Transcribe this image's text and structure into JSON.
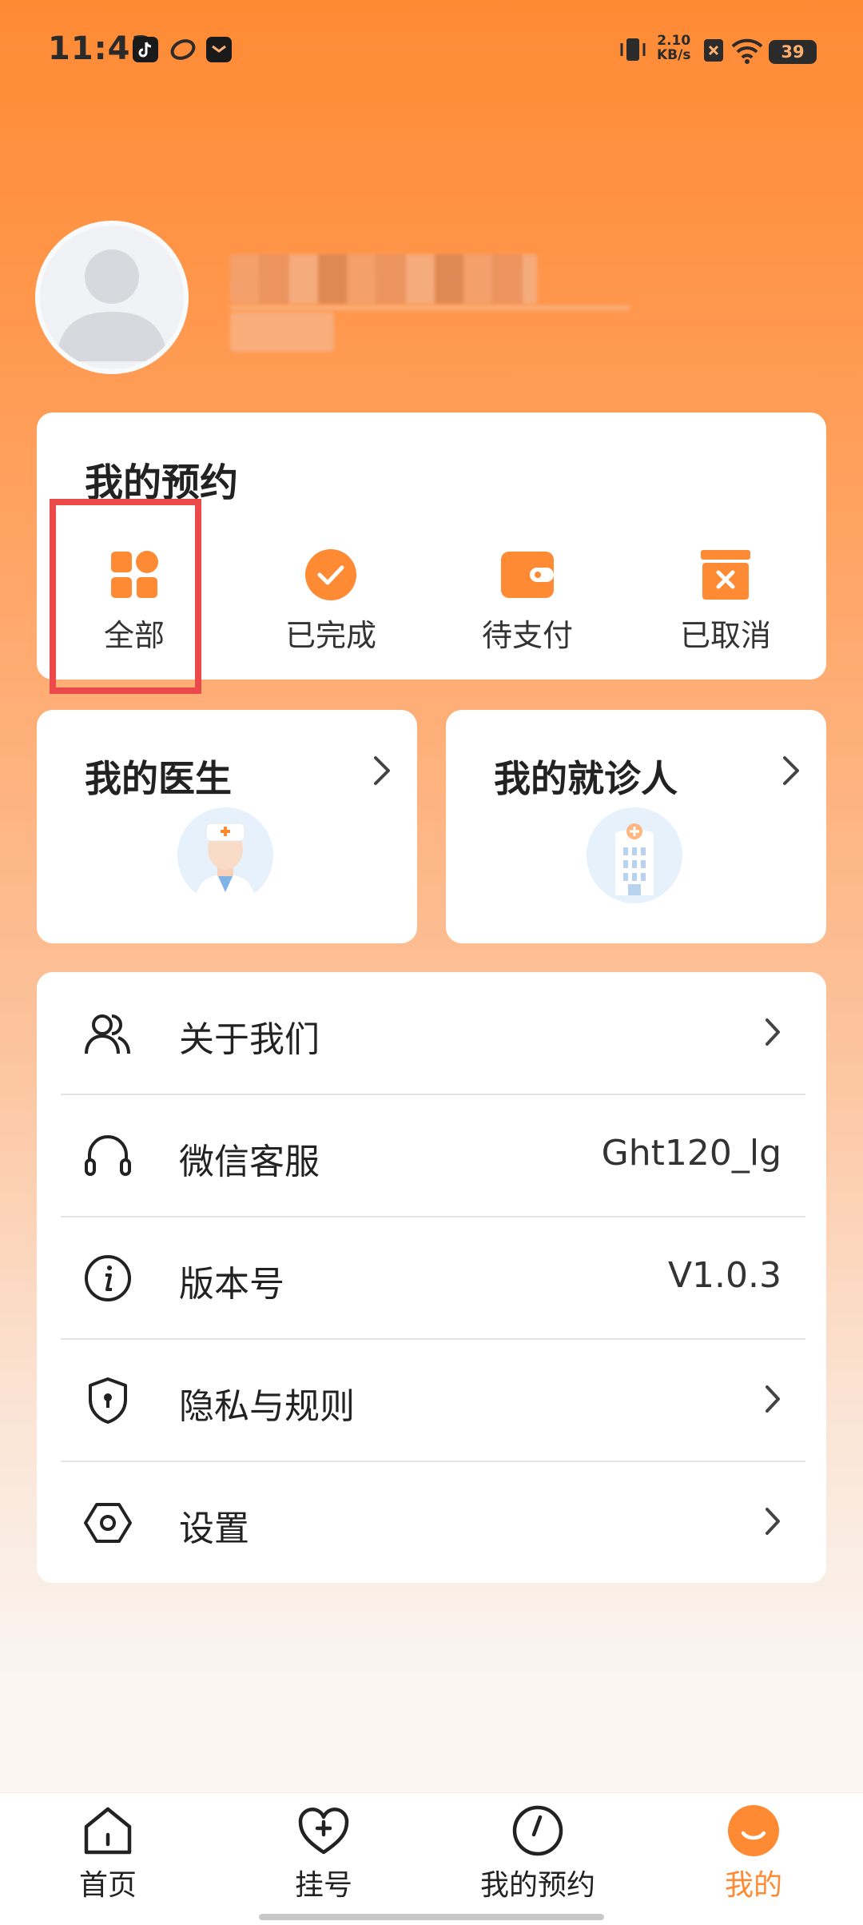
{
  "status_bar": {
    "time": "11:43",
    "net_speed_value": "2.10",
    "net_speed_unit": "KB/s",
    "battery": "39"
  },
  "appointments": {
    "title": "我的预约",
    "items": [
      {
        "label": "全部",
        "icon": "grid-icon"
      },
      {
        "label": "已完成",
        "icon": "check-circle-icon"
      },
      {
        "label": "待支付",
        "icon": "wallet-icon"
      },
      {
        "label": "已取消",
        "icon": "cancel-box-icon"
      }
    ]
  },
  "quick_cards": {
    "doctor": {
      "title": "我的医生",
      "icon": "doctor-avatar-icon"
    },
    "patient": {
      "title": "我的就诊人",
      "icon": "hospital-icon"
    }
  },
  "menu": [
    {
      "label": "关于我们",
      "icon": "people-icon",
      "value": ""
    },
    {
      "label": "微信客服",
      "icon": "headset-icon",
      "value": "Ght120_lg"
    },
    {
      "label": "版本号",
      "icon": "info-icon",
      "value": "V1.0.3"
    },
    {
      "label": "隐私与规则",
      "icon": "shield-lock-icon",
      "value": ""
    },
    {
      "label": "设置",
      "icon": "settings-hex-icon",
      "value": ""
    }
  ],
  "bottom_nav": [
    {
      "label": "首页",
      "icon": "home-icon"
    },
    {
      "label": "挂号",
      "icon": "heart-plus-icon"
    },
    {
      "label": "我的预约",
      "icon": "clock-icon"
    },
    {
      "label": "我的",
      "icon": "smile-bubble-icon",
      "active": true
    }
  ],
  "colors": {
    "accent": "#ff8a34",
    "highlight": "#ec4a4a"
  }
}
